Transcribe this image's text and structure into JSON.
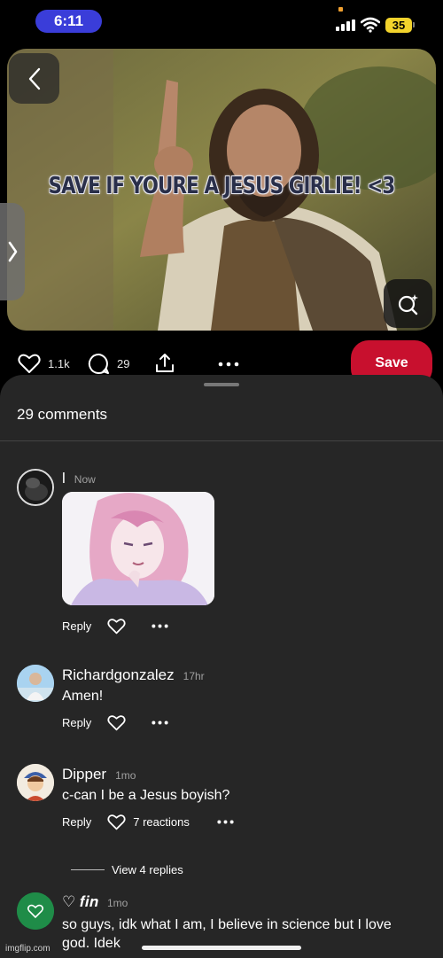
{
  "status_bar": {
    "time": "6:11",
    "battery": "35"
  },
  "pin": {
    "caption": "SAVE IF YOURE A JESUS GIRLIE! <3",
    "likes": "1.1k",
    "comments_count": "29",
    "save_label": "Save"
  },
  "comments_sheet": {
    "title": "29 comments",
    "comments": [
      {
        "user": "l",
        "time": "Now",
        "text": "",
        "reply_label": "Reply",
        "reactions": ""
      },
      {
        "user": "Richardgonzalez",
        "time": "17hr",
        "text": "Amen!",
        "reply_label": "Reply",
        "reactions": ""
      },
      {
        "user": "Dipper",
        "time": "1mo",
        "text": "c-can I be a Jesus boyish?",
        "reply_label": "Reply",
        "reactions": "7 reactions"
      },
      {
        "user": "♡ 𝒇𝒊𝒏",
        "time": "1mo",
        "text": "so guys, idk what I am, I believe in science but I love god. Idek",
        "reply_label": "",
        "reactions": ""
      }
    ],
    "view_replies": "View 4 replies"
  },
  "watermark": "imgflip.com",
  "colors": {
    "save": "#c8102e",
    "sheet": "#262626",
    "time_pill": "#3a3dd9",
    "battery": "#f2d32c"
  }
}
